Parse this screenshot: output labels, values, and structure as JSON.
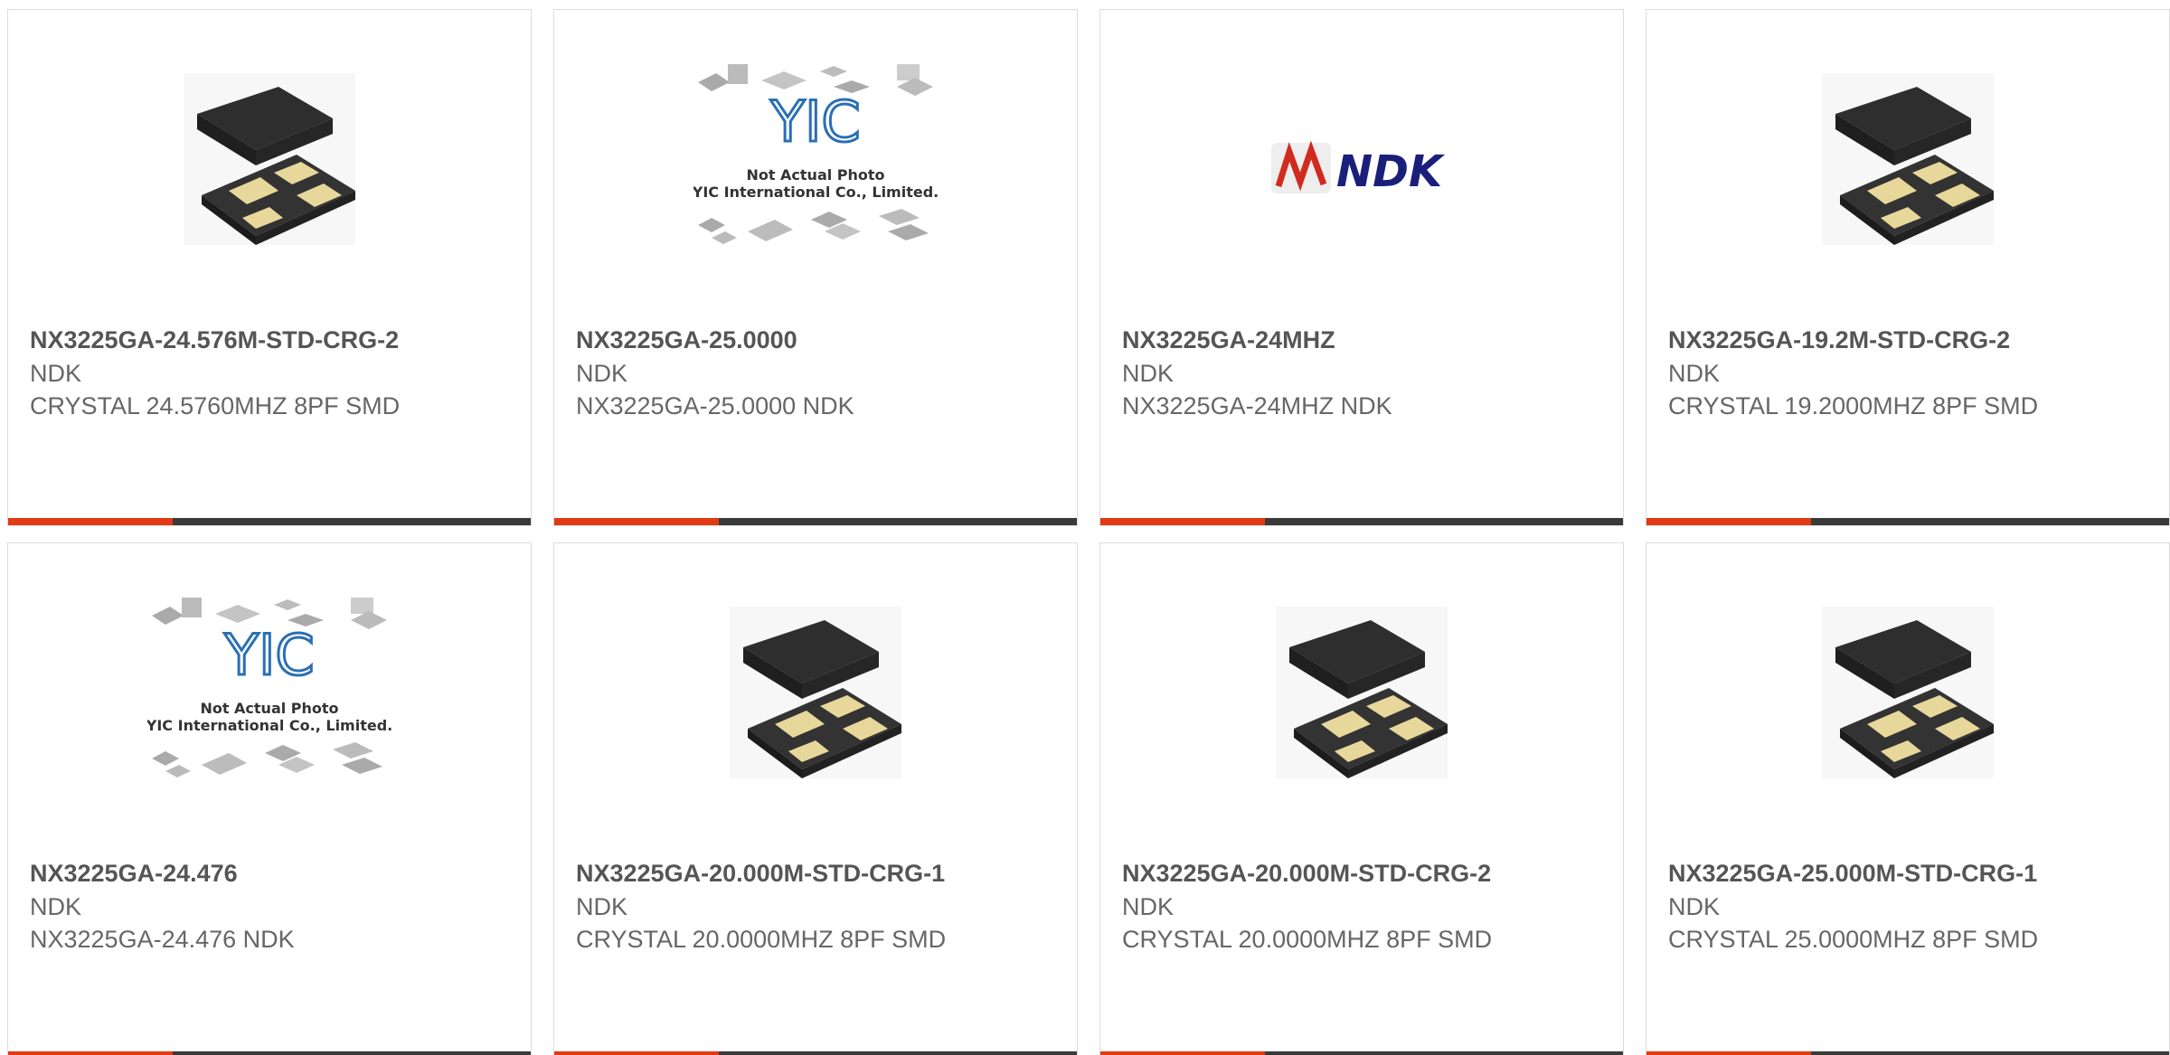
{
  "colors": {
    "accent": "#e23a12",
    "bar": "#3a3a3a",
    "title": "#555555",
    "text": "#666666"
  },
  "products": [
    {
      "part": "NX3225GA-24.576M-STD-CRG-2",
      "manufacturer": "NDK",
      "desc": "CRYSTAL 24.5760MHZ 8PF SMD",
      "image": "crystal-smd"
    },
    {
      "part": "NX3225GA-25.0000",
      "manufacturer": "NDK",
      "desc": "NX3225GA-25.0000 NDK",
      "image": "yic-placeholder"
    },
    {
      "part": "NX3225GA-24MHZ",
      "manufacturer": "NDK",
      "desc": "NX3225GA-24MHZ NDK",
      "image": "ndk-logo"
    },
    {
      "part": "NX3225GA-19.2M-STD-CRG-2",
      "manufacturer": "NDK",
      "desc": "CRYSTAL 19.2000MHZ 8PF SMD",
      "image": "crystal-smd"
    },
    {
      "part": "NX3225GA-24.476",
      "manufacturer": "NDK",
      "desc": "NX3225GA-24.476 NDK",
      "image": "yic-placeholder"
    },
    {
      "part": "NX3225GA-20.000M-STD-CRG-1",
      "manufacturer": "NDK",
      "desc": "CRYSTAL 20.0000MHZ 8PF SMD",
      "image": "crystal-smd"
    },
    {
      "part": "NX3225GA-20.000M-STD-CRG-2",
      "manufacturer": "NDK",
      "desc": "CRYSTAL 20.0000MHZ 8PF SMD",
      "image": "crystal-smd"
    },
    {
      "part": "NX3225GA-25.000M-STD-CRG-1",
      "manufacturer": "NDK",
      "desc": "CRYSTAL 25.0000MHZ 8PF SMD",
      "image": "crystal-smd"
    }
  ],
  "yic": {
    "brand": "YIC",
    "line1": "Not Actual Photo",
    "line2": "YIC International Co., Limited."
  },
  "ndk_logo": {
    "brand": "NDK"
  }
}
